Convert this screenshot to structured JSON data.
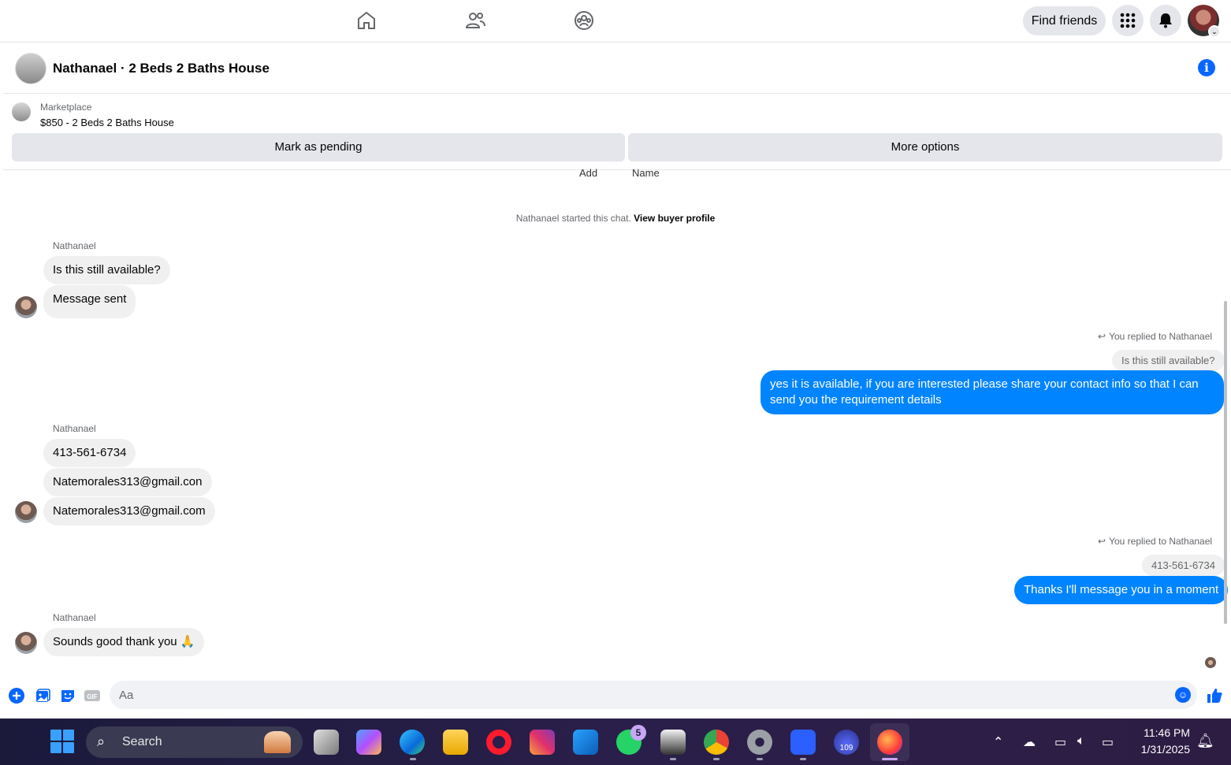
{
  "topnav": {
    "find_friends_label": "Find friends"
  },
  "chat": {
    "title": "Nathanael · 2 Beds 2 Baths House"
  },
  "marketplace": {
    "label": "Marketplace",
    "listing": "$850 - 2 Beds 2 Baths House",
    "mark_pending_label": "Mark as pending",
    "more_options_label": "More options"
  },
  "partial_labels": {
    "add": "Add",
    "name": "Name"
  },
  "system": {
    "started_text": "Nathanael started this chat.",
    "profile_link": "View buyer profile"
  },
  "messages": {
    "group1_sender": "Nathanael",
    "m1": "Is this still available?",
    "m2": "Message sent",
    "reply1_label": "You replied to Nathanael",
    "reply1_ref": "Is this still available?",
    "out1_line1": "yes it is available, if you are interested please share your contact info so that I can",
    "out1_line2": "send you the requirement details",
    "group2_sender": "Nathanael",
    "m3": "413-561-6734",
    "m4": "Natemorales313@gmail.con",
    "m5": "Natemorales313@gmail.com",
    "reply2_label": "You replied to Nathanael",
    "reply2_ref": "413-561-6734",
    "out2": "Thanks I'll message you in a moment",
    "group3_sender": "Nathanael",
    "m6": "Sounds good thank you 🙏"
  },
  "composer": {
    "placeholder": "Aa",
    "gif_label": "GIF"
  },
  "taskbar": {
    "search_label": "Search",
    "whatsapp_badge": "5",
    "app_count": "109",
    "time": "11:46 PM",
    "date": "1/31/2025"
  },
  "colors": {
    "accent": "#0866ff",
    "outgoing_bubble": "#0084ff",
    "incoming_bubble": "#f0f0f0",
    "button_gray": "#e4e6eb"
  }
}
